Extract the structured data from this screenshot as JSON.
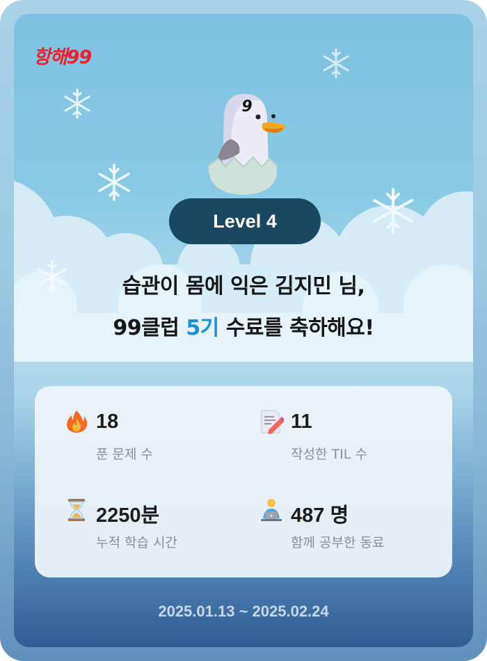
{
  "brand": {
    "logo_text": "항해99",
    "logo_color": "#e8212e"
  },
  "mascot": {
    "head_number": "9"
  },
  "level": {
    "label": "Level 4"
  },
  "headline": {
    "line1": "습관이 몸에 익은 김지민 님,",
    "line2_prefix": "99클럽 ",
    "line2_accent": "5기",
    "line2_suffix": " 수료를 축하해요!",
    "accent_color": "#1d8fd8"
  },
  "stats": [
    {
      "icon": "fire-icon",
      "value": "18",
      "label": "푼 문제 수"
    },
    {
      "icon": "memo-pencil-icon",
      "value": "11",
      "label": "작성한 TIL 수"
    },
    {
      "icon": "hourglass-icon",
      "value": "2250분",
      "label": "누적 학습 시간"
    },
    {
      "icon": "person-laptop-icon",
      "value": "487 명",
      "label": "함께 공부한 동료"
    }
  ],
  "period": {
    "text": "2025.01.13 ~ 2025.02.24"
  }
}
